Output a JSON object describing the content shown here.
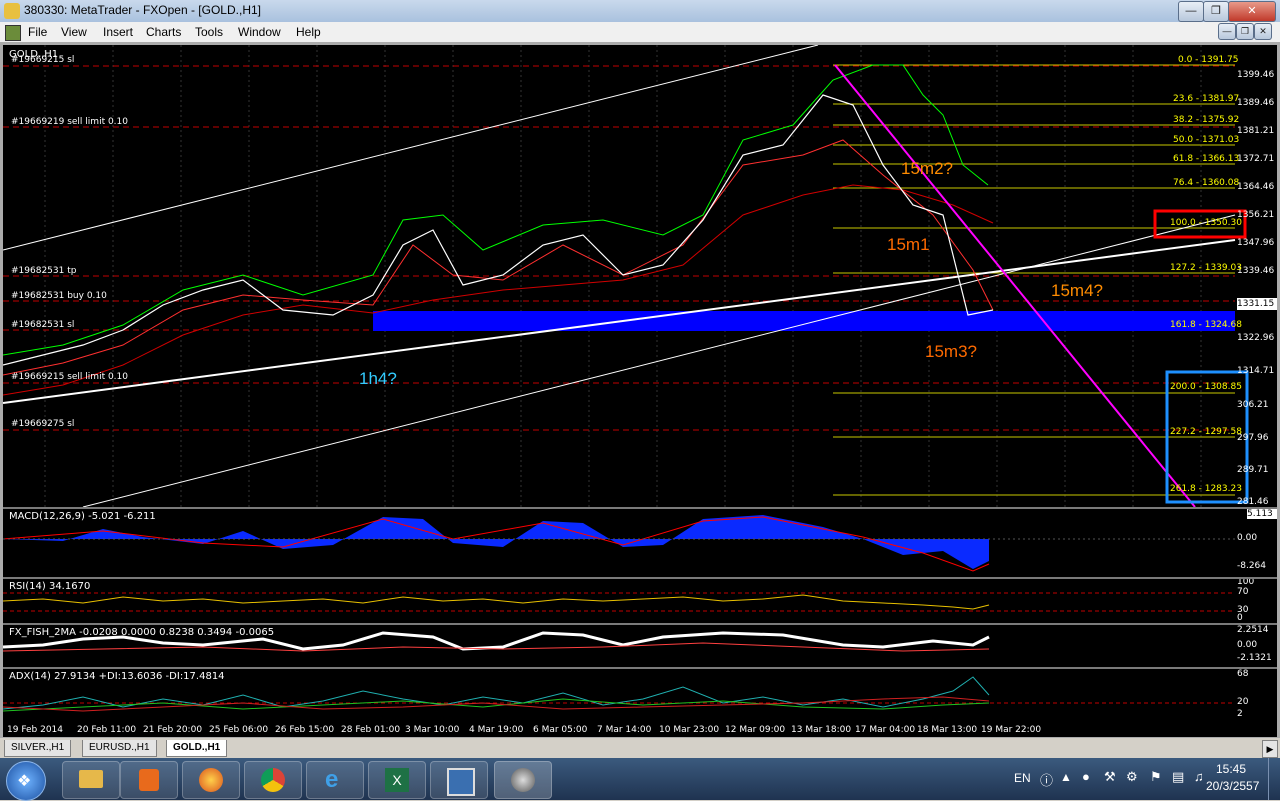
{
  "window": {
    "title": "380330: MetaTrader - FXOpen - [GOLD.,H1]"
  },
  "menu": [
    "File",
    "View",
    "Insert",
    "Charts",
    "Tools",
    "Window",
    "Help"
  ],
  "chart": {
    "symbol_label": "GOLD.,H1",
    "price_scale": [
      "1399.46",
      "1389.46",
      "1381.21",
      "1372.71",
      "1364.46",
      "1356.21",
      "1347.96",
      "1339.46",
      "1331.15",
      "1322.96",
      "1314.71",
      "306.21",
      "297.96",
      "289.71",
      "281.46"
    ],
    "fib_levels": [
      {
        "label": "0.0 - 1391.75"
      },
      {
        "label": "23.6 - 1381.97"
      },
      {
        "label": "38.2 - 1375.92"
      },
      {
        "label": "50.0 - 1371.03"
      },
      {
        "label": "61.8 - 1366.13"
      },
      {
        "label": "76.4 - 1360.08"
      },
      {
        "label": "100.0 - 1350.30"
      },
      {
        "label": "127.2 - 1339.03"
      },
      {
        "label": "161.8 - 1324.68"
      },
      {
        "label": "200.0 - 1308.85"
      },
      {
        "label": "227.2 - 1297.58"
      },
      {
        "label": "261.8 - 1283.23"
      }
    ],
    "orders": [
      {
        "label": "#19669215 sl"
      },
      {
        "label": "#19669219 sell limit 0.10"
      },
      {
        "label": "#19682531 tp"
      },
      {
        "label": "#19682531 buy 0.10"
      },
      {
        "label": "#19682531 sl"
      },
      {
        "label": "#19669215 sell limit 0.10"
      },
      {
        "label": "#19669275 sl"
      }
    ],
    "annotations": [
      {
        "text": "15m2?",
        "color": "#ff8c00"
      },
      {
        "text": "15m1",
        "color": "#ff6a00"
      },
      {
        "text": "15m4?",
        "color": "#ff8c00"
      },
      {
        "text": "15m3?",
        "color": "#ff6a00"
      },
      {
        "text": "1h4?",
        "color": "#33ccff"
      }
    ],
    "dates": [
      "19 Feb 2014",
      "20 Feb 11:00",
      "21 Feb 20:00",
      "25 Feb 06:00",
      "26 Feb 15:00",
      "28 Feb 01:00",
      "3 Mar 10:00",
      "4 Mar 19:00",
      "6 Mar 05:00",
      "7 Mar 14:00",
      "10 Mar 23:00",
      "12 Mar 09:00",
      "13 Mar 18:00",
      "17 Mar 04:00",
      "18 Mar 13:00",
      "19 Mar 22:00"
    ]
  },
  "indicators": {
    "macd": {
      "label": "MACD(12,26,9) -5.021 -6.211",
      "scale": [
        "0.00",
        "-8.264"
      ],
      "badge": "5.113"
    },
    "rsi": {
      "label": "RSI(14) 34.1670",
      "scale": [
        "100",
        "70",
        "30",
        "0"
      ]
    },
    "fish": {
      "label": "FX_FISH_2MA -0.0208 0.0000 0.8238 0.3494 -0.0065",
      "scale": [
        "2.2514",
        "0.00",
        "-2.1321"
      ]
    },
    "adx": {
      "label": "ADX(14) 27.9134 +DI:13.6036 -DI:17.4814",
      "scale": [
        "68",
        "20",
        "2"
      ]
    }
  },
  "tabs": [
    "SILVER.,H1",
    "EURUSD.,H1",
    "GOLD.,H1"
  ],
  "active_tab": "GOLD.,H1",
  "tray": {
    "lang": "EN",
    "time": "15:45",
    "date": "20/3/2557"
  }
}
